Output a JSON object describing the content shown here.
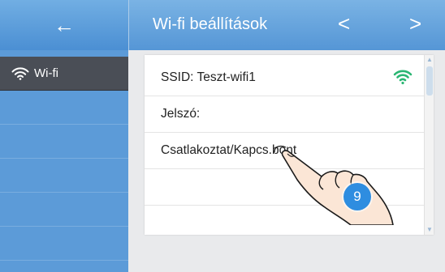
{
  "header": {
    "back_icon": "←",
    "title": "Wi-fi beállítások",
    "prev_icon": "<",
    "next_icon": ">"
  },
  "sidebar": {
    "items": [
      {
        "label": "Wi-fi",
        "icon": "wifi-icon",
        "active": true
      }
    ]
  },
  "panel": {
    "rows": [
      {
        "label": "SSID: Teszt-wifi1",
        "icon": "wifi-signal-icon"
      },
      {
        "label": "Jelszó:"
      },
      {
        "label": "Csatlakoztat/Kapcs.bont"
      },
      {
        "label": ""
      }
    ]
  },
  "overlay": {
    "step_number": "9"
  },
  "colors": {
    "header_blue": "#5c9bd8",
    "active_item": "#4a4e56",
    "signal_green": "#2bb673",
    "badge_blue": "#2e8de0"
  }
}
